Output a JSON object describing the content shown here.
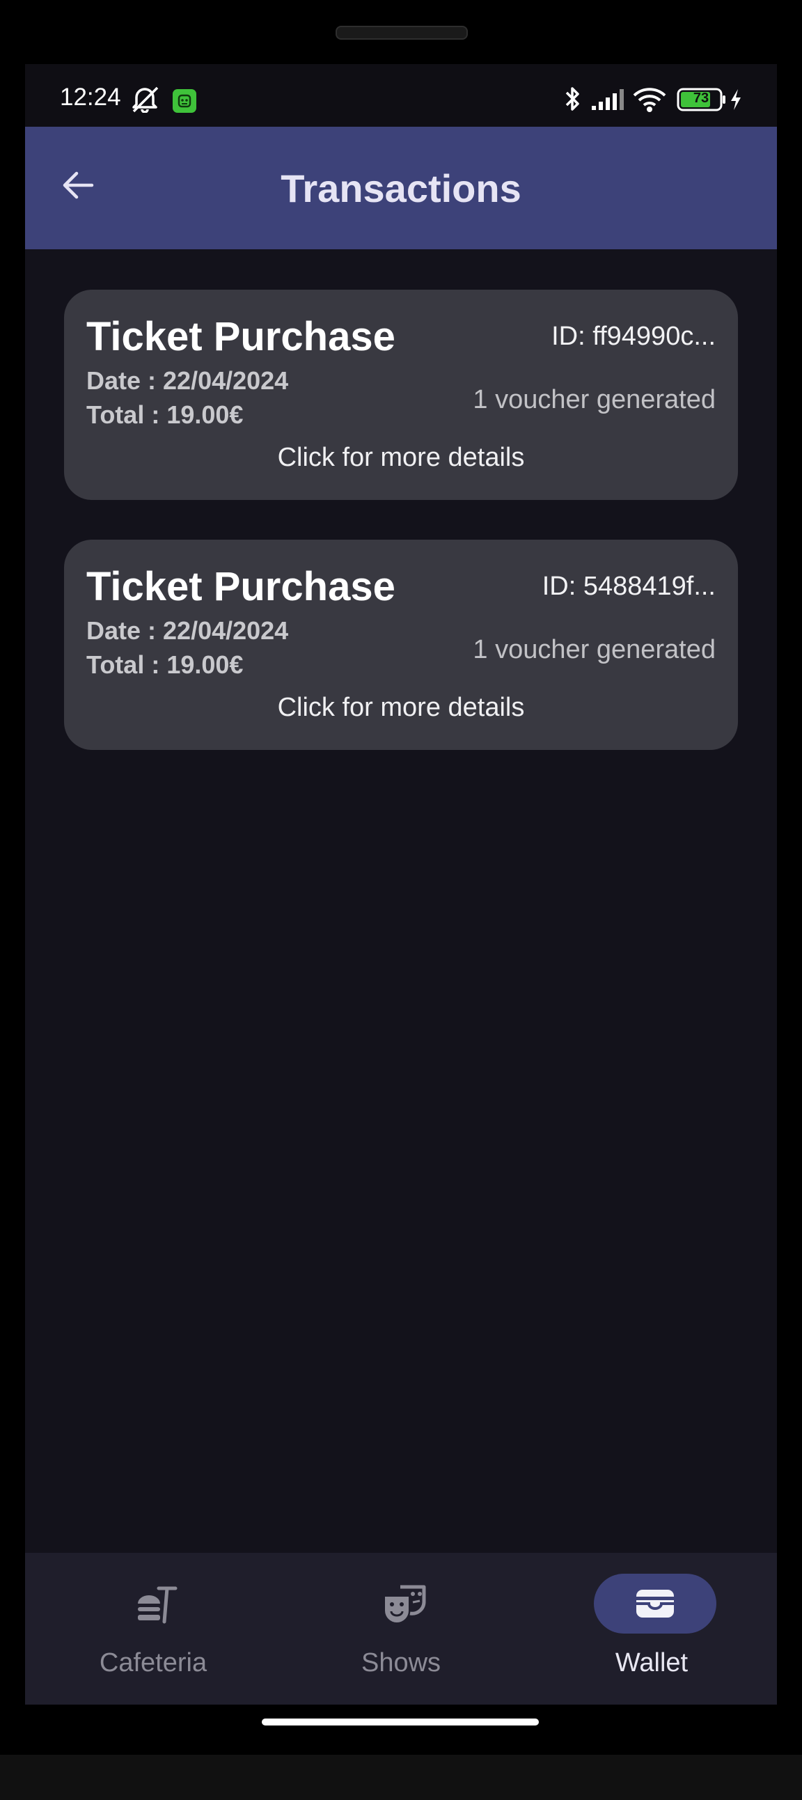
{
  "status_bar": {
    "time": "12:24",
    "battery_level": "73",
    "icons": [
      "mute-bell-icon",
      "app-notification-icon",
      "bluetooth-icon",
      "signal-icon",
      "wifi-icon",
      "battery-icon",
      "charging-icon"
    ]
  },
  "app_bar": {
    "title": "Transactions",
    "back_icon": "arrow-left-icon"
  },
  "transactions": [
    {
      "title": "Ticket Purchase",
      "id": "ID: ff94990c...",
      "date": "Date : 22/04/2024",
      "total": "Total : 19.00€",
      "vouchers": "1 voucher generated",
      "details": "Click for more details"
    },
    {
      "title": "Ticket Purchase",
      "id": "ID: 5488419f...",
      "date": "Date : 22/04/2024",
      "total": "Total : 19.00€",
      "vouchers": "1 voucher generated",
      "details": "Click for more details"
    }
  ],
  "bottom_nav": {
    "items": [
      {
        "label": "Cafeteria",
        "icon": "fastfood-icon",
        "active": false
      },
      {
        "label": "Shows",
        "icon": "theater-masks-icon",
        "active": false
      },
      {
        "label": "Wallet",
        "icon": "wallet-icon",
        "active": true
      }
    ]
  },
  "colors": {
    "app_bar": "#3d4279",
    "background": "#13121b",
    "card": "#393941",
    "nav_background": "#1f1e2b",
    "active_pill": "#3d4279"
  }
}
